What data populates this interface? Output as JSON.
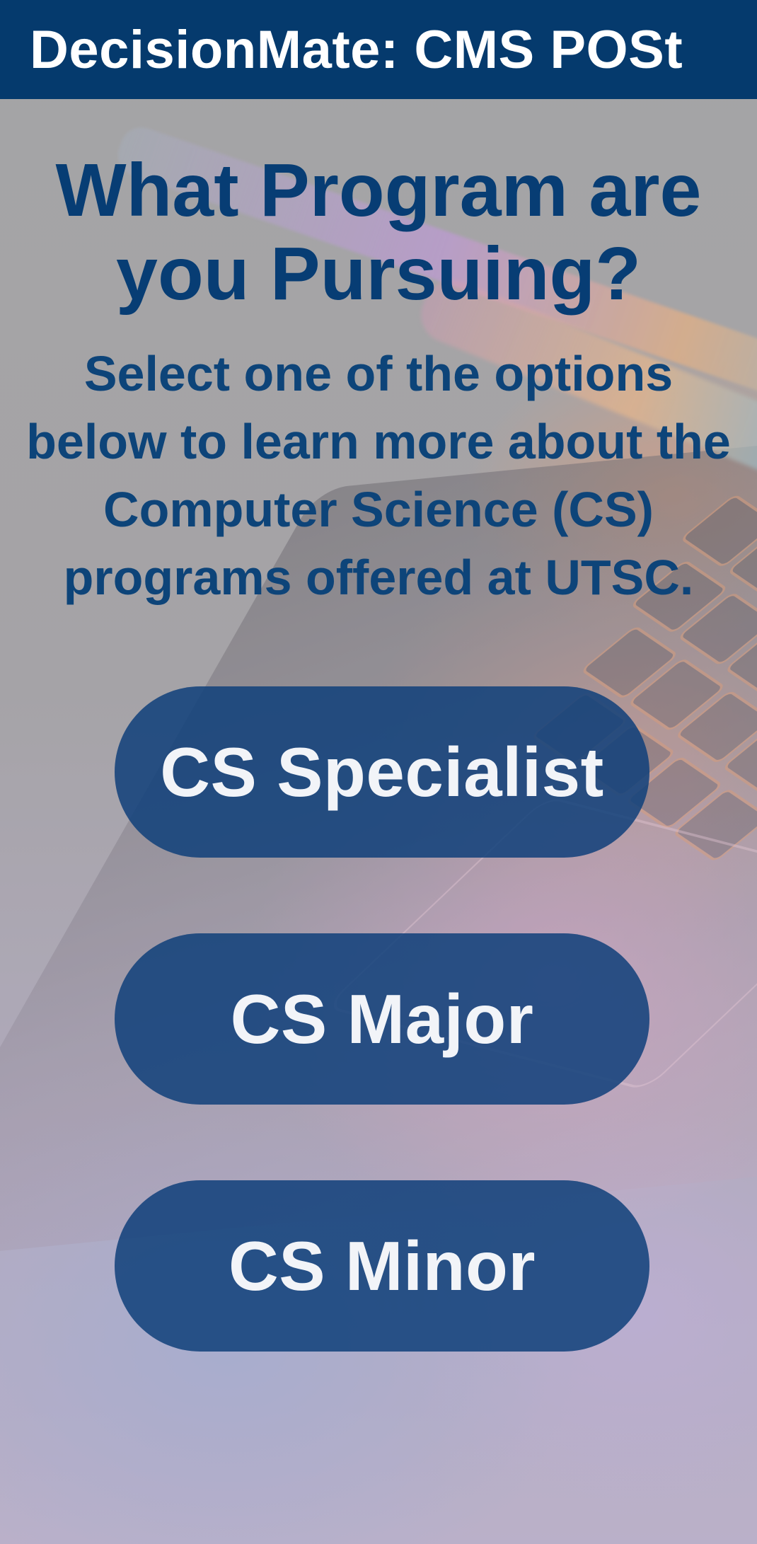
{
  "app_bar": {
    "title": "DecisionMate: CMS POSt"
  },
  "main": {
    "headline": "What Program are you Pursuing?",
    "description": "Select one of the options below to learn more about the Computer Science (CS) programs offered at UTSC."
  },
  "options": [
    {
      "label": "CS Specialist"
    },
    {
      "label": "CS Major"
    },
    {
      "label": "CS Minor"
    }
  ],
  "colors": {
    "app_bar_background": "#053a6d",
    "heading_text": "#073d74",
    "button_background": "#10407a",
    "button_text": "#f2f4f8"
  },
  "background_image": "laptop-keyboard-photo"
}
